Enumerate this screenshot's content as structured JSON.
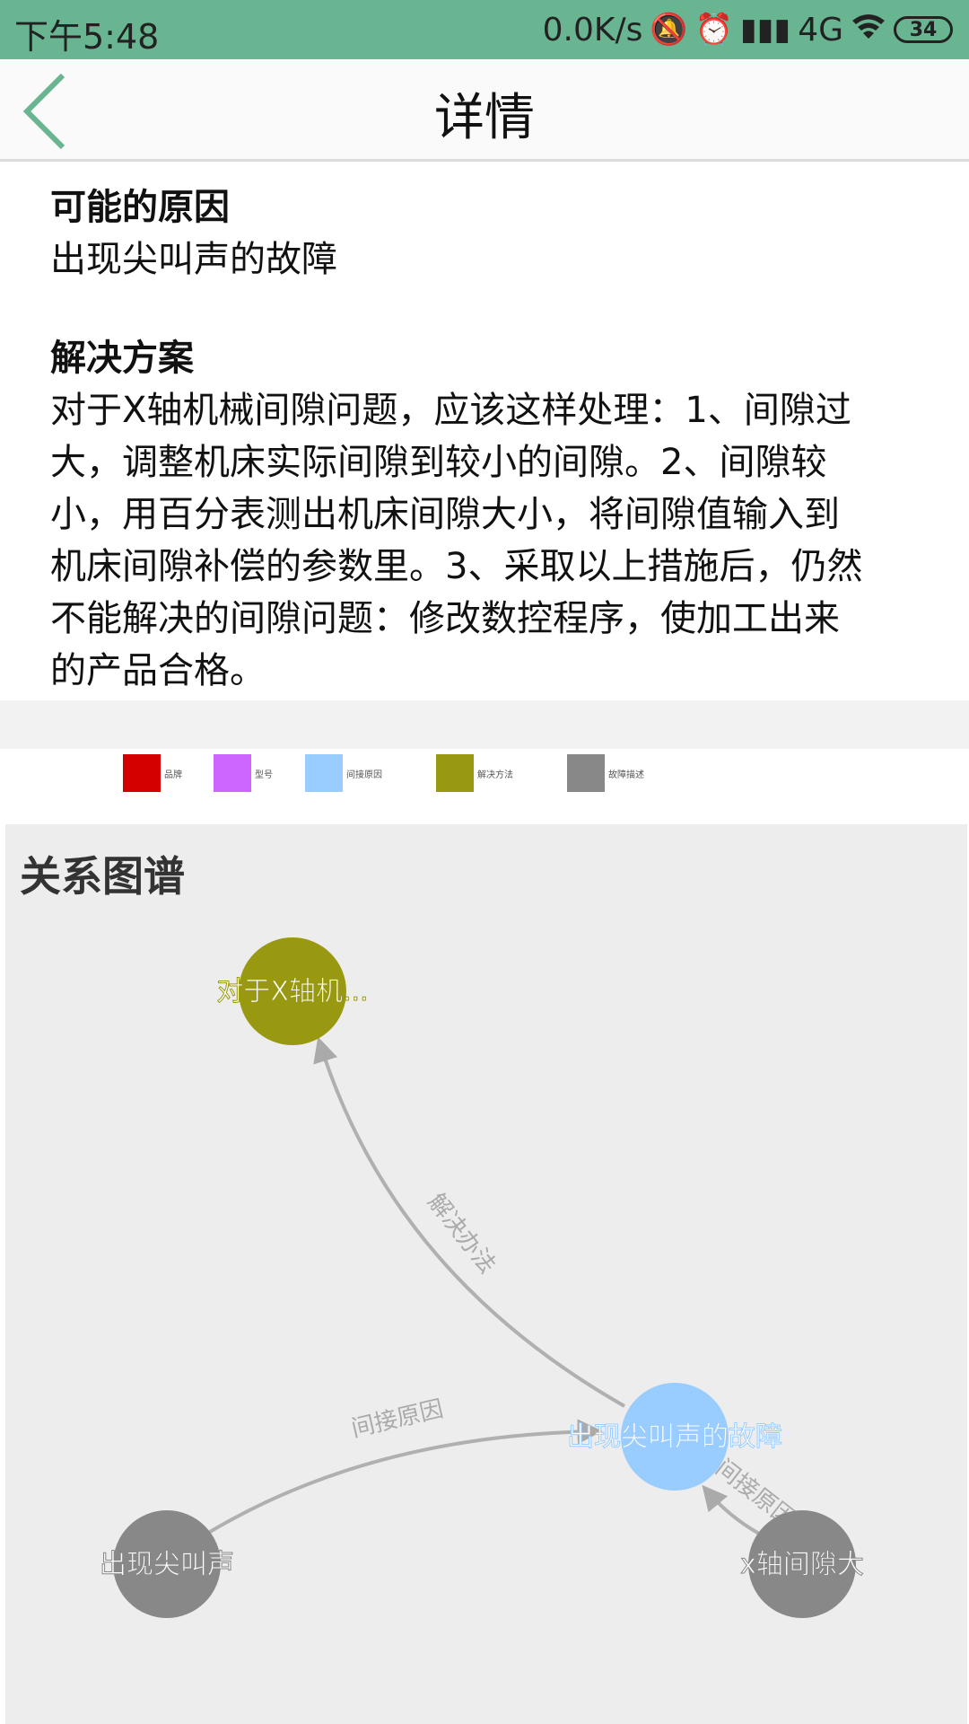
{
  "status_bar": {
    "time": "下午5:48",
    "net_speed": "0.0K/s",
    "network": "4G",
    "battery": "34",
    "icons": [
      "bell-off-icon",
      "alarm-icon",
      "signal-icon",
      "wifi-icon"
    ]
  },
  "header": {
    "title": "详情",
    "back_icon": "chevron-left-icon",
    "accent_color": "#69b591"
  },
  "detail": {
    "cause_heading": "可能的原因",
    "cause_text": "出现尖叫声的故障",
    "solution_heading": "解决方案",
    "solution_lines": [
      "对于X轴机械间隙问题，应该这样处理：1、间隙过",
      "大，调整机床实际间隙到较小的间隙。2、间隙较",
      "小，用百分表测出机床间隙大小，将间隙值输入到",
      "机床间隙补偿的参数里。3、采取以上措施后，仍然",
      "不能解决的间隙问题：修改数控程序，使加工出来",
      "的产品合格。"
    ]
  },
  "legend": [
    {
      "label": "品牌",
      "color": "#d40000"
    },
    {
      "label": "型号",
      "color": "#cc66ff"
    },
    {
      "label": "间接原因",
      "color": "#99ccff"
    },
    {
      "label": "解决方法",
      "color": "#999911"
    },
    {
      "label": "故障描述",
      "color": "#888888"
    }
  ],
  "graph": {
    "title": "关系图谱",
    "nodes": [
      {
        "id": "solution",
        "label": "对于X轴机...",
        "color": "#999911"
      },
      {
        "id": "fault",
        "label": "出现尖叫声的故障",
        "color": "#99ccff"
      },
      {
        "id": "desc1",
        "label": "出现尖叫声",
        "color": "#888888"
      },
      {
        "id": "desc2",
        "label": "x轴间隙大",
        "color": "#888888"
      }
    ],
    "edges": [
      {
        "from": "fault",
        "to": "solution",
        "label": "解决办法"
      },
      {
        "from": "desc1",
        "to": "fault",
        "label": "间接原因"
      },
      {
        "from": "desc2",
        "to": "fault",
        "label": "间接原因"
      }
    ]
  }
}
